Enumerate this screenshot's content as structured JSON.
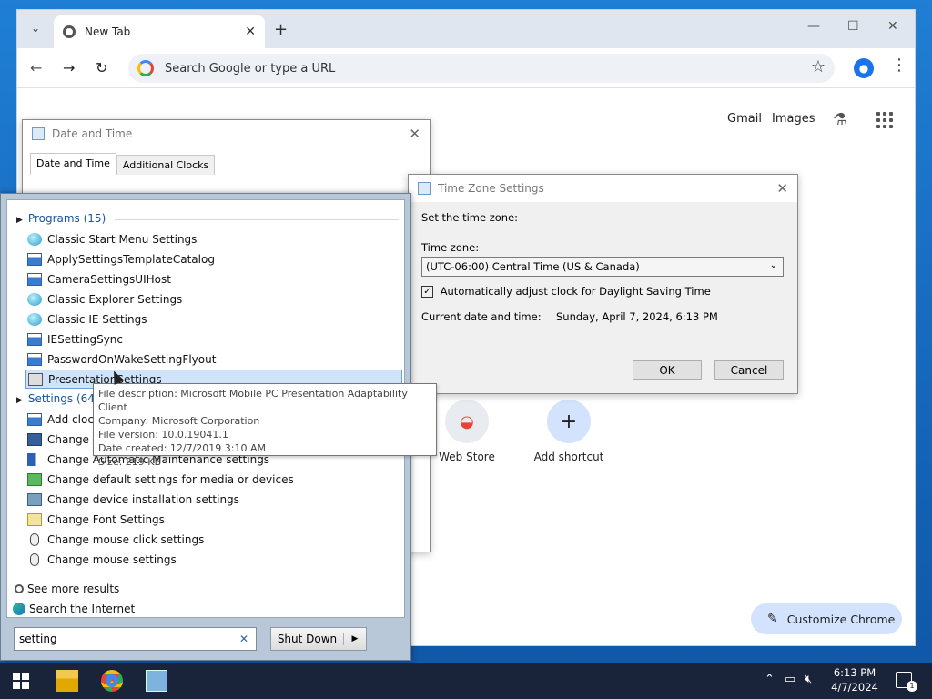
{
  "browser": {
    "tab_title": "New Tab",
    "omnibox_placeholder": "Search Google or type a URL",
    "header_links": [
      "Gmail",
      "Images"
    ],
    "shortcuts": [
      {
        "label": "Web Store"
      },
      {
        "label": "Add shortcut"
      }
    ],
    "customize_label": "Customize Chrome"
  },
  "date_time_dialog": {
    "title": "Date and Time",
    "tabs": [
      "Date and Time",
      "Additional Clocks"
    ]
  },
  "timezone_dialog": {
    "title": "Time Zone Settings",
    "set_label": "Set the time zone:",
    "tz_label": "Time zone:",
    "tz_value": "(UTC-06:00) Central Time (US & Canada)",
    "dst_label": "Automatically adjust clock for Daylight Saving Time",
    "dst_checked": true,
    "current_label": "Current date and time:",
    "current_value": "Sunday, April 7, 2024, 6:13 PM",
    "ok_label": "OK",
    "cancel_label": "Cancel"
  },
  "start_menu": {
    "programs_header": "Programs (15)",
    "programs": [
      {
        "label": "Classic Start Menu Settings",
        "icon": "ball"
      },
      {
        "label": "ApplySettingsTemplateCatalog",
        "icon": "win"
      },
      {
        "label": "CameraSettingsUIHost",
        "icon": "win"
      },
      {
        "label": "Classic Explorer Settings",
        "icon": "ball"
      },
      {
        "label": "Classic IE Settings",
        "icon": "ball"
      },
      {
        "label": "IESettingSync",
        "icon": "win"
      },
      {
        "label": "PasswordOnWakeSettingFlyout",
        "icon": "win"
      },
      {
        "label": "PresentationSettings",
        "icon": "kbd",
        "selected": true
      }
    ],
    "settings_header": "Settings (64)",
    "settings": [
      {
        "label": "Add clock",
        "icon": "win"
      },
      {
        "label": "Change a",
        "icon": "mon"
      },
      {
        "label": "Change Automatic Maintenance settings",
        "icon": "flag"
      },
      {
        "label": "Change default settings for media or devices",
        "icon": "media"
      },
      {
        "label": "Change device installation settings",
        "icon": "dev"
      },
      {
        "label": "Change Font Settings",
        "icon": "font"
      },
      {
        "label": "Change mouse click settings",
        "icon": "mouse"
      },
      {
        "label": "Change mouse settings",
        "icon": "mouse"
      }
    ],
    "see_more": "See more results",
    "search_internet": "Search the Internet",
    "search_value": "setting",
    "shutdown_label": "Shut Down"
  },
  "tooltip": {
    "lines": [
      "File description: Microsoft Mobile PC Presentation Adaptability Client",
      "Company: Microsoft Corporation",
      "File version: 10.0.19041.1",
      "Date created: 12/7/2019 3:10 AM",
      "Size: 219 KB"
    ]
  },
  "taskbar": {
    "time": "6:13 PM",
    "date": "4/7/2024",
    "notification_count": "1"
  }
}
